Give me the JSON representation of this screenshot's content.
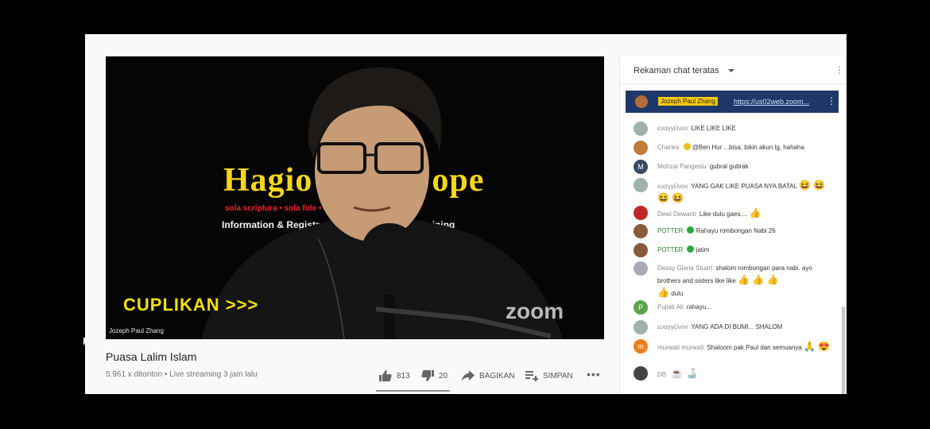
{
  "video": {
    "banner_title_left": "Hagio",
    "banner_title_right": "ope",
    "banner_motto": "sola scriptura • sola fide • • soli Deo gloria",
    "banner_info": "Information & Registr                         Online Training",
    "overlay_text": "CUPLIKAN >>>",
    "speaker_name": "Jozeph Paul Zhang",
    "watermark": "zoom",
    "title": "Puasa Lalim Islam",
    "meta": "5.961 x ditonton • Live streaming 3 jam lalu"
  },
  "actions": {
    "like_count": "813",
    "dislike_count": "20",
    "share_label": "BAGIKAN",
    "save_label": "SIMPAN",
    "more_label": "•••",
    "like_ratio": 0.976
  },
  "chat": {
    "header_title": "Rekaman chat teratas",
    "menu_glyph": "⋮",
    "pinned": {
      "author": "Jozeph Paul Zhang",
      "link": "https://us02web.zoom...",
      "menu_glyph": "⋮"
    },
    "messages": [
      {
        "author": "ευαγγέλιον",
        "text": "LIKE LIKE LIKE",
        "avatar_color": "#9fb3a9",
        "avatar_letter": ""
      },
      {
        "author": "Charles",
        "text": "@Ben Hur ...bisa, bikin akun lg, hahaha",
        "avatar_color": "#c07a3a",
        "avatar_letter": ""
      },
      {
        "author": "Mohzai Pangestu",
        "text": "gubral gubrak",
        "avatar_color": "#3b4a63",
        "avatar_letter": "M"
      },
      {
        "author": "ευαγγέλιον",
        "text": "YANG GAK LIKE PUASA NYA BATAL",
        "emoji": "😆 😆 😆 😆",
        "avatar_color": "#9fb3a9",
        "avatar_letter": ""
      },
      {
        "author": "Dewi Dewanti",
        "text": "Like dulu gaes....",
        "emoji": "👍",
        "avatar_color": "#c0282a",
        "avatar_letter": ""
      },
      {
        "author": "POTTER",
        "text": "Rahayu rombongan Nabi 26",
        "avatar_color": "#8a5a3a",
        "avatar_letter": ""
      },
      {
        "author": "POTTER",
        "text": "jatim",
        "avatar_color": "#8a5a3a",
        "avatar_letter": ""
      },
      {
        "author": "Dessy Gloria Stuart",
        "text": "shalom rombongan para nabi. ayo brothers and sisters like like",
        "emoji": "👍 👍 👍",
        "text2": "dulu",
        "emoji2": "👍",
        "avatar_color": "#a9a9b9",
        "avatar_letter": ""
      },
      {
        "author": "Pujiati Ati",
        "text": "rahayu...",
        "avatar_color": "#5aa34a",
        "avatar_letter": "P"
      },
      {
        "author": "ευαγγέλιον",
        "text": "YANG ADA DI BUMI... SHALOM",
        "avatar_color": "#9fb3a9",
        "avatar_letter": ""
      },
      {
        "author": "murwati murwati",
        "text": "Shaloom pak Paul dan semuanya",
        "emoji": "🙏 😍",
        "avatar_color": "#ef7d1a",
        "avatar_letter": "m"
      },
      {
        "author": "DB",
        "text": "",
        "emoji": "☕ 🍶",
        "avatar_color": "#444444",
        "avatar_letter": ""
      }
    ]
  }
}
